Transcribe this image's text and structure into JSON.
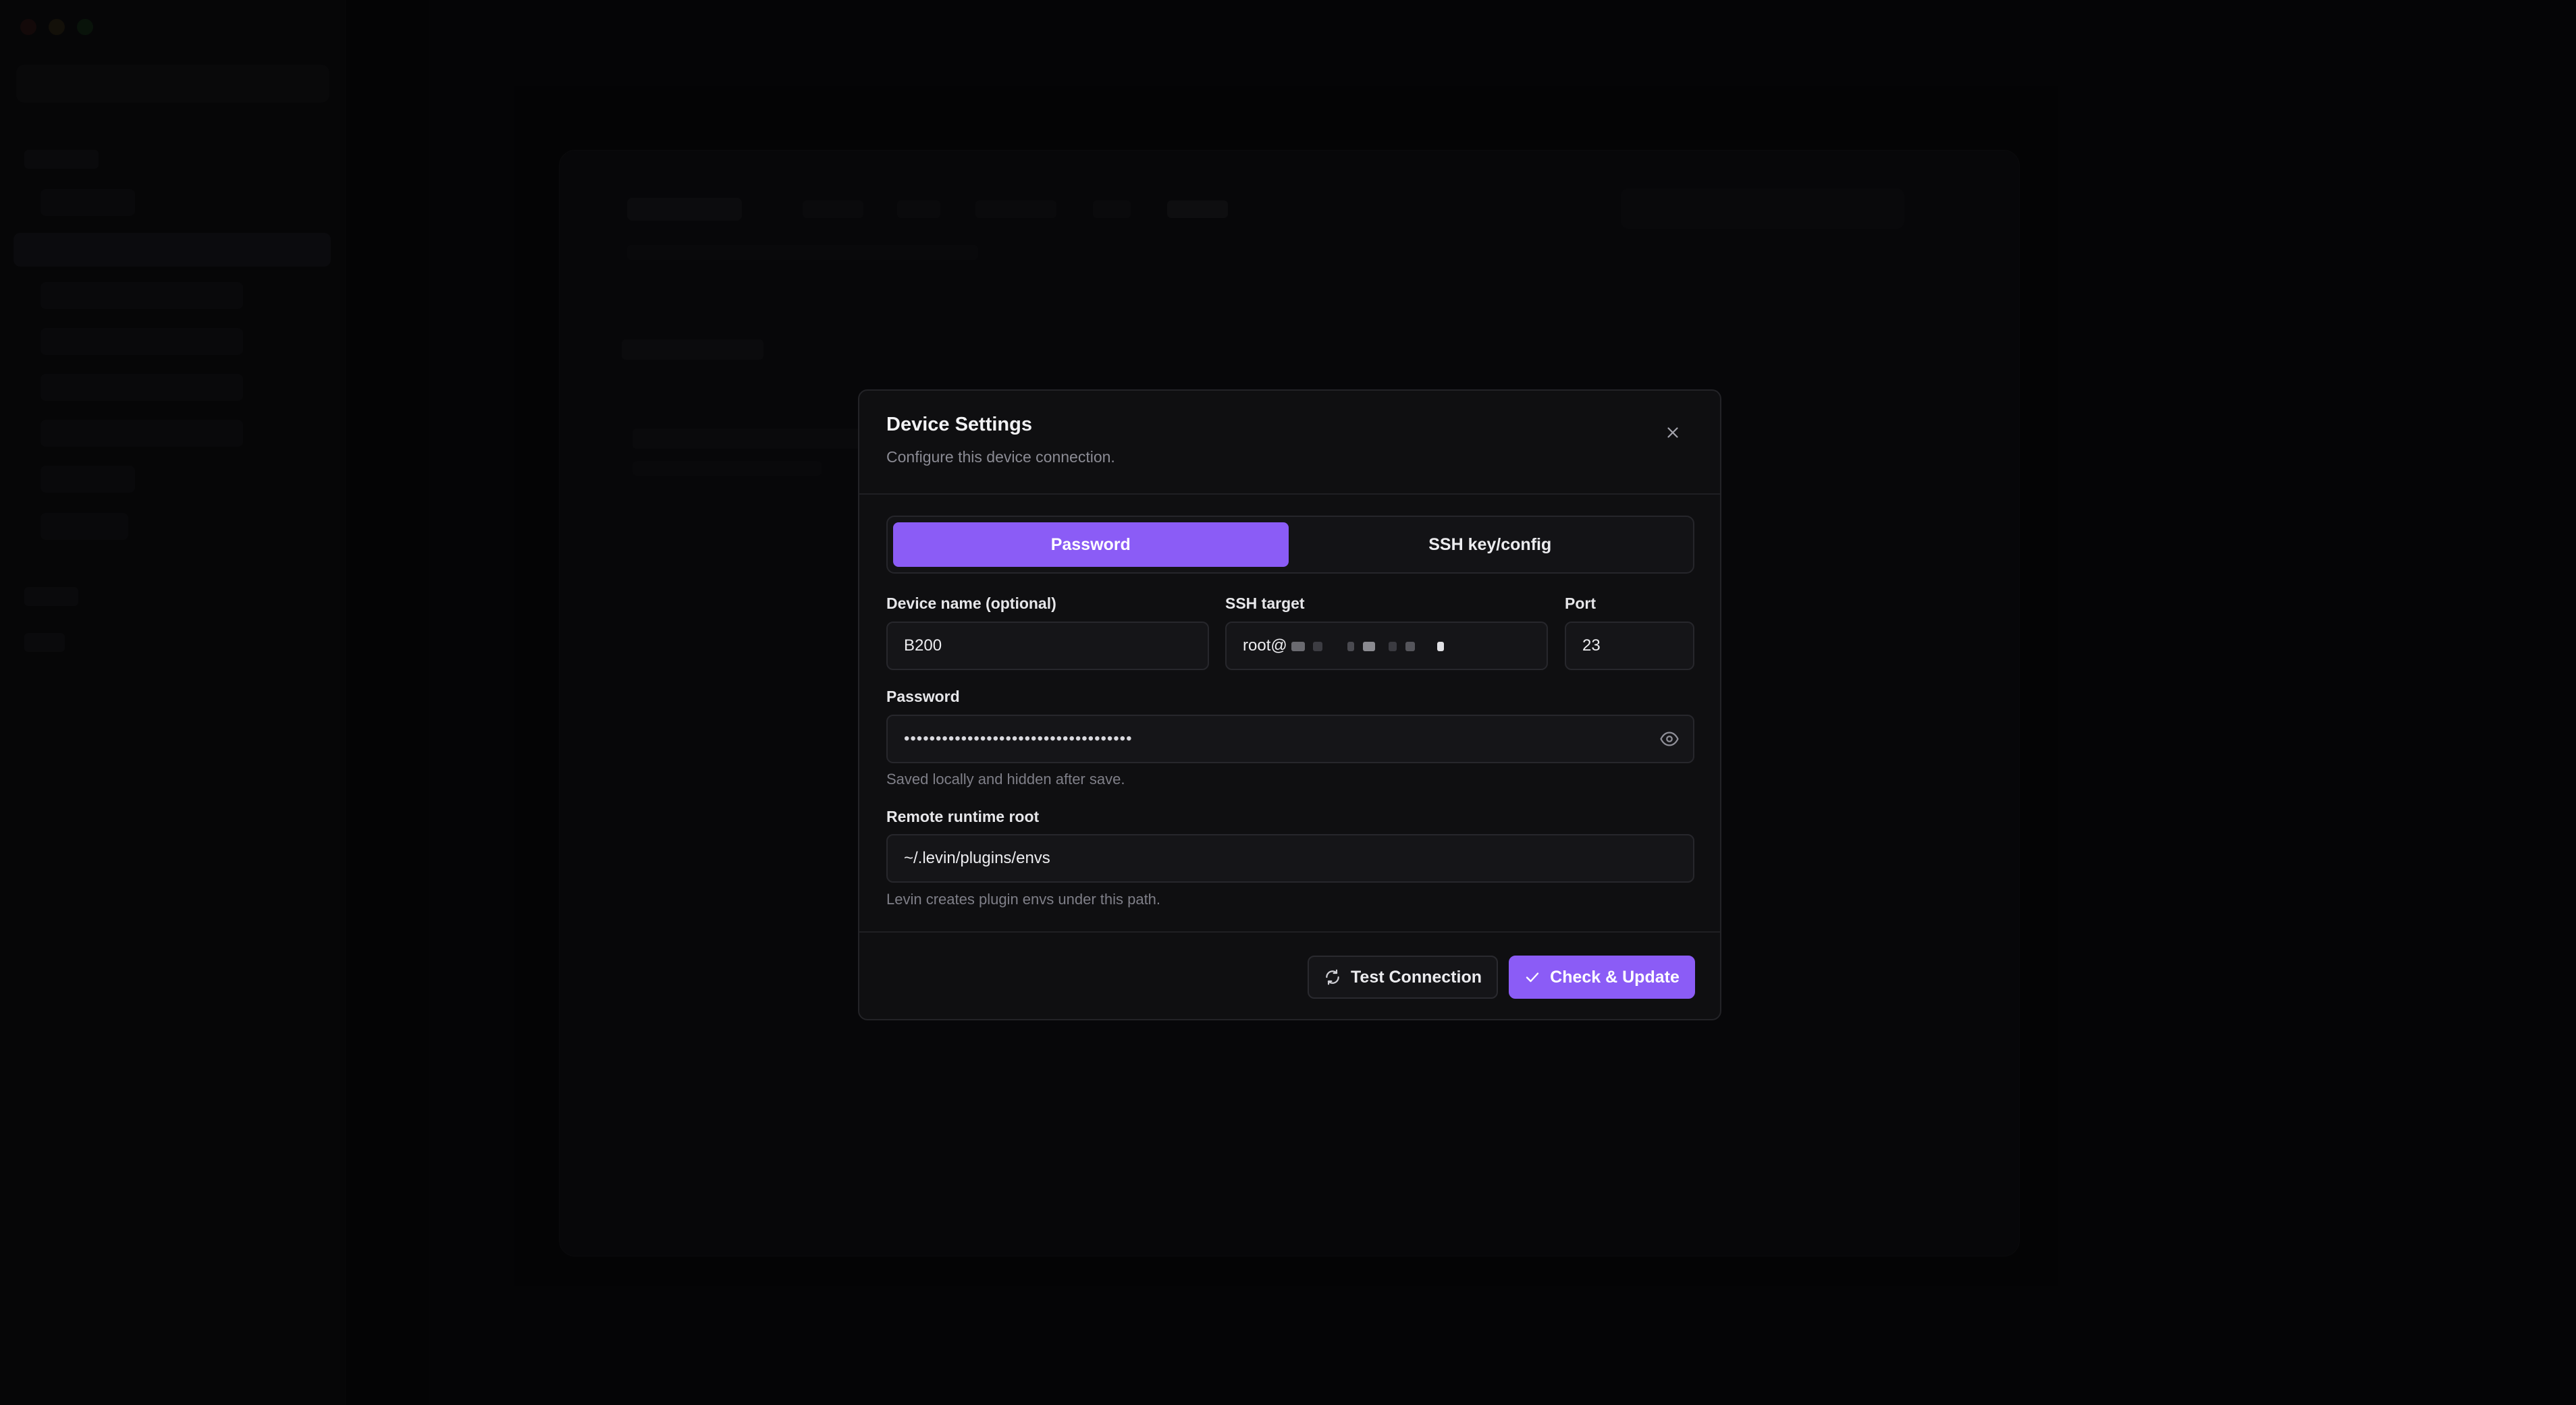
{
  "modal": {
    "title": "Device Settings",
    "description": "Configure this device connection.",
    "auth_tabs": [
      {
        "label": "Password",
        "active": true
      },
      {
        "label": "SSH key/config",
        "active": false
      }
    ],
    "fields": {
      "device_name": {
        "label": "Device name (optional)",
        "value": "B200"
      },
      "ssh_target": {
        "label": "SSH target",
        "value_prefix": "root@"
      },
      "port": {
        "label": "Port",
        "value": "23"
      },
      "password": {
        "label": "Password",
        "masked_value": "••••••••••••••••••••••••••••••••••••",
        "hint": "Saved locally and hidden after save."
      },
      "runtime_root": {
        "label": "Remote runtime root",
        "value": "~/.levin/plugins/envs",
        "hint": "Levin creates plugin envs under this path."
      }
    },
    "buttons": {
      "test": "Test Connection",
      "primary": "Check & Update"
    },
    "icons": {
      "close": "close-icon",
      "eye": "eye-icon",
      "refresh": "refresh-icon",
      "check": "check-icon"
    }
  },
  "colors": {
    "accent": "#8b5cf6",
    "modal_bg": "#0f0f11",
    "overlay_bg": "#000000"
  }
}
